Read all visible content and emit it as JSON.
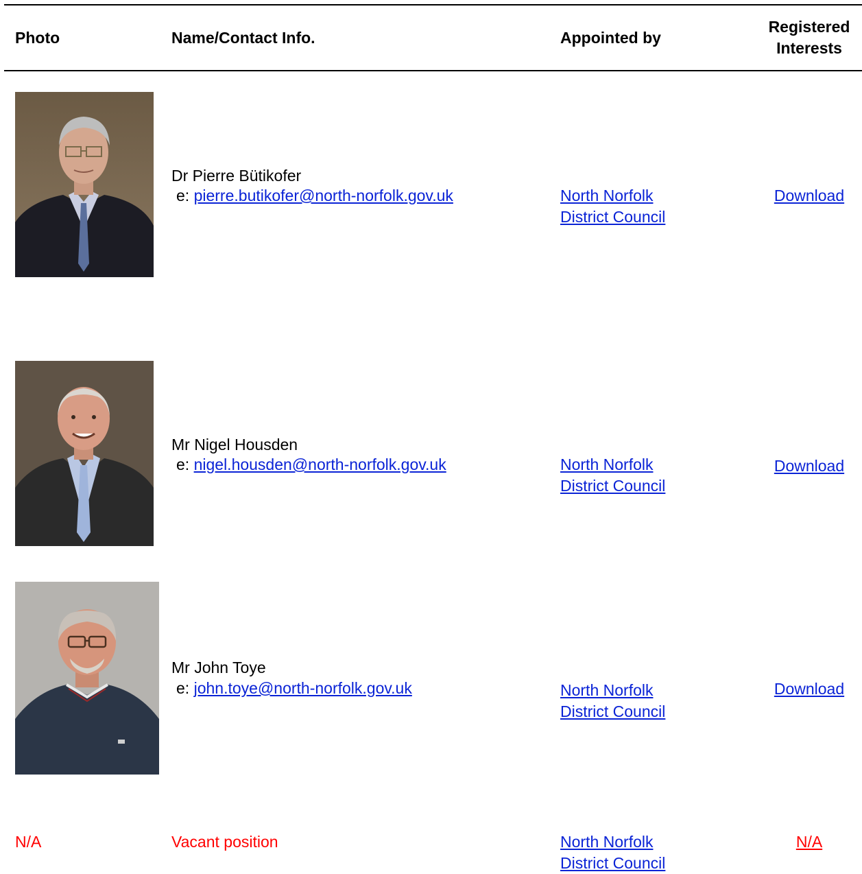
{
  "table": {
    "headers": {
      "photo": "Photo",
      "name": "Name/Contact Info.",
      "appointed": "Appointed by",
      "registered_line1": "Registered",
      "registered_line2": "Interests"
    },
    "rows": [
      {
        "name": "Dr Pierre Bütikofer",
        "email_prefix": "e:",
        "email": "pierre.butikofer@north-norfolk.gov.uk",
        "appointed_line1": "North Norfolk",
        "appointed_line2": "District Council",
        "interests": "Download"
      },
      {
        "name": "Mr Nigel Housden",
        "email_prefix": "e:",
        "email": "nigel.housden@north-norfolk.gov.uk",
        "appointed_line1": "North Norfolk",
        "appointed_line2": "District Council",
        "interests": "Download"
      },
      {
        "name": "Mr John Toye",
        "email_prefix": "e:",
        "email": "john.toye@north-norfolk.gov.uk",
        "appointed_line1": "North Norfolk",
        "appointed_line2": "District Council",
        "interests": "Download"
      },
      {
        "photo": "N/A",
        "name": "Vacant position",
        "appointed_line1": "North Norfolk",
        "appointed_line2": "District Council",
        "interests": "N/A"
      }
    ]
  },
  "colors": {
    "link": "#0a23d6",
    "vacant": "#ff0000",
    "text": "#000000"
  }
}
